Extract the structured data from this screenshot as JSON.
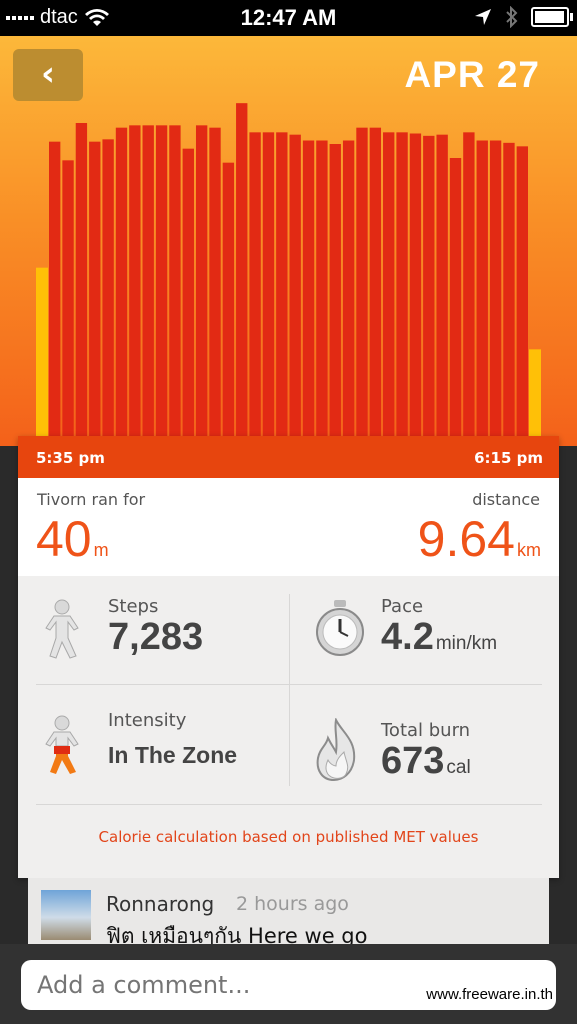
{
  "status_bar": {
    "carrier": "dtac",
    "time": "12:47 AM"
  },
  "header": {
    "back_icon": "chevron-left-icon",
    "date": "APR 27"
  },
  "chart_data": {
    "type": "bar",
    "title": "",
    "start_label": "5:35 pm",
    "end_label": "6:15 pm",
    "colors": {
      "bar": "#e22a14",
      "edge_bar": "#ffc007"
    },
    "ylim": [
      0,
      300
    ],
    "edge_values": [
      146,
      76
    ],
    "values": [
      254,
      238,
      270,
      254,
      256,
      266,
      268,
      268,
      268,
      268,
      248,
      268,
      266,
      236,
      287,
      262,
      262,
      262,
      260,
      255,
      255,
      252,
      255,
      266,
      266,
      262,
      262,
      261,
      259,
      260,
      240,
      262,
      255,
      255,
      253,
      250
    ]
  },
  "summary": {
    "ran_label": "Tivorn ran for",
    "ran_value": "40",
    "ran_unit": "m",
    "distance_label": "distance",
    "distance_value": "9.64",
    "distance_unit": "km"
  },
  "stats": {
    "steps": {
      "label": "Steps",
      "value": "7,283",
      "icon": "walking-figure-icon"
    },
    "pace": {
      "label": "Pace",
      "value": "4.2",
      "unit": "min/km",
      "icon": "stopwatch-icon"
    },
    "intensity": {
      "label": "Intensity",
      "value": "In The Zone",
      "icon": "intensity-figure-icon"
    },
    "burn": {
      "label": "Total burn",
      "value": "673",
      "unit": "cal",
      "icon": "flame-icon"
    }
  },
  "note": "Calorie calculation based on published MET values",
  "feed": {
    "name": "Ronnarong",
    "time_ago": "2 hours ago",
    "message": "ฟิต เหมือนๆกัน Here we go"
  },
  "comment": {
    "placeholder": "Add a comment..."
  },
  "watermark": "www.freeware.in.th"
}
